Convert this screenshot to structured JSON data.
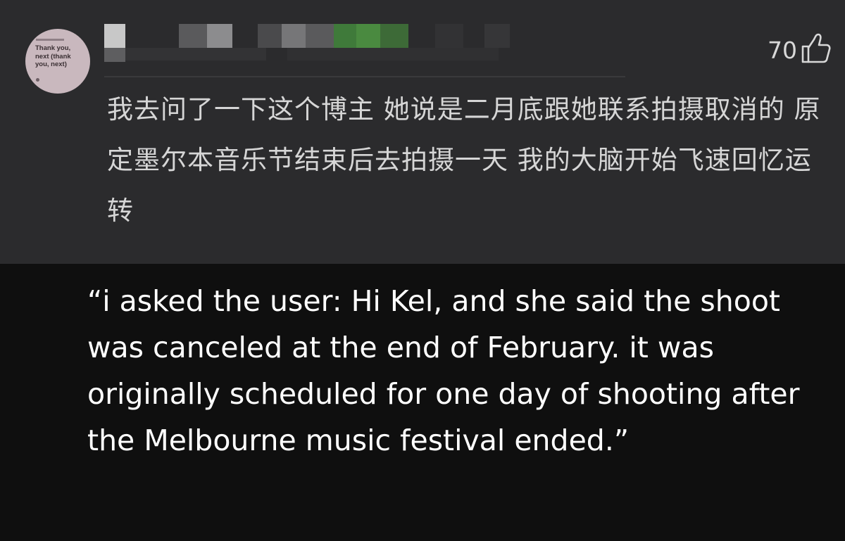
{
  "comment": {
    "avatar_text": "Thank you,\nnext (thank\nyou, next)",
    "like_count": "70",
    "text": "我去问了一下这个博主 她说是二月底跟她联系拍摄取消的 原定墨尔本音乐节结束后去拍摄一天 我的大脑开始飞速回忆运转"
  },
  "icons": {
    "like": "thumbs-up-icon"
  },
  "translation": {
    "text": "“i asked the user: Hi Kel, and she said the shoot was canceled at the end of February. it was originally scheduled for one day of shooting after the Melbourne music festival ended.”"
  },
  "colors": {
    "card_background": "#2b2b2d",
    "caption_background": "#0f0f0f",
    "comment_text": "#d6d6d6",
    "caption_text": "#ffffff"
  }
}
